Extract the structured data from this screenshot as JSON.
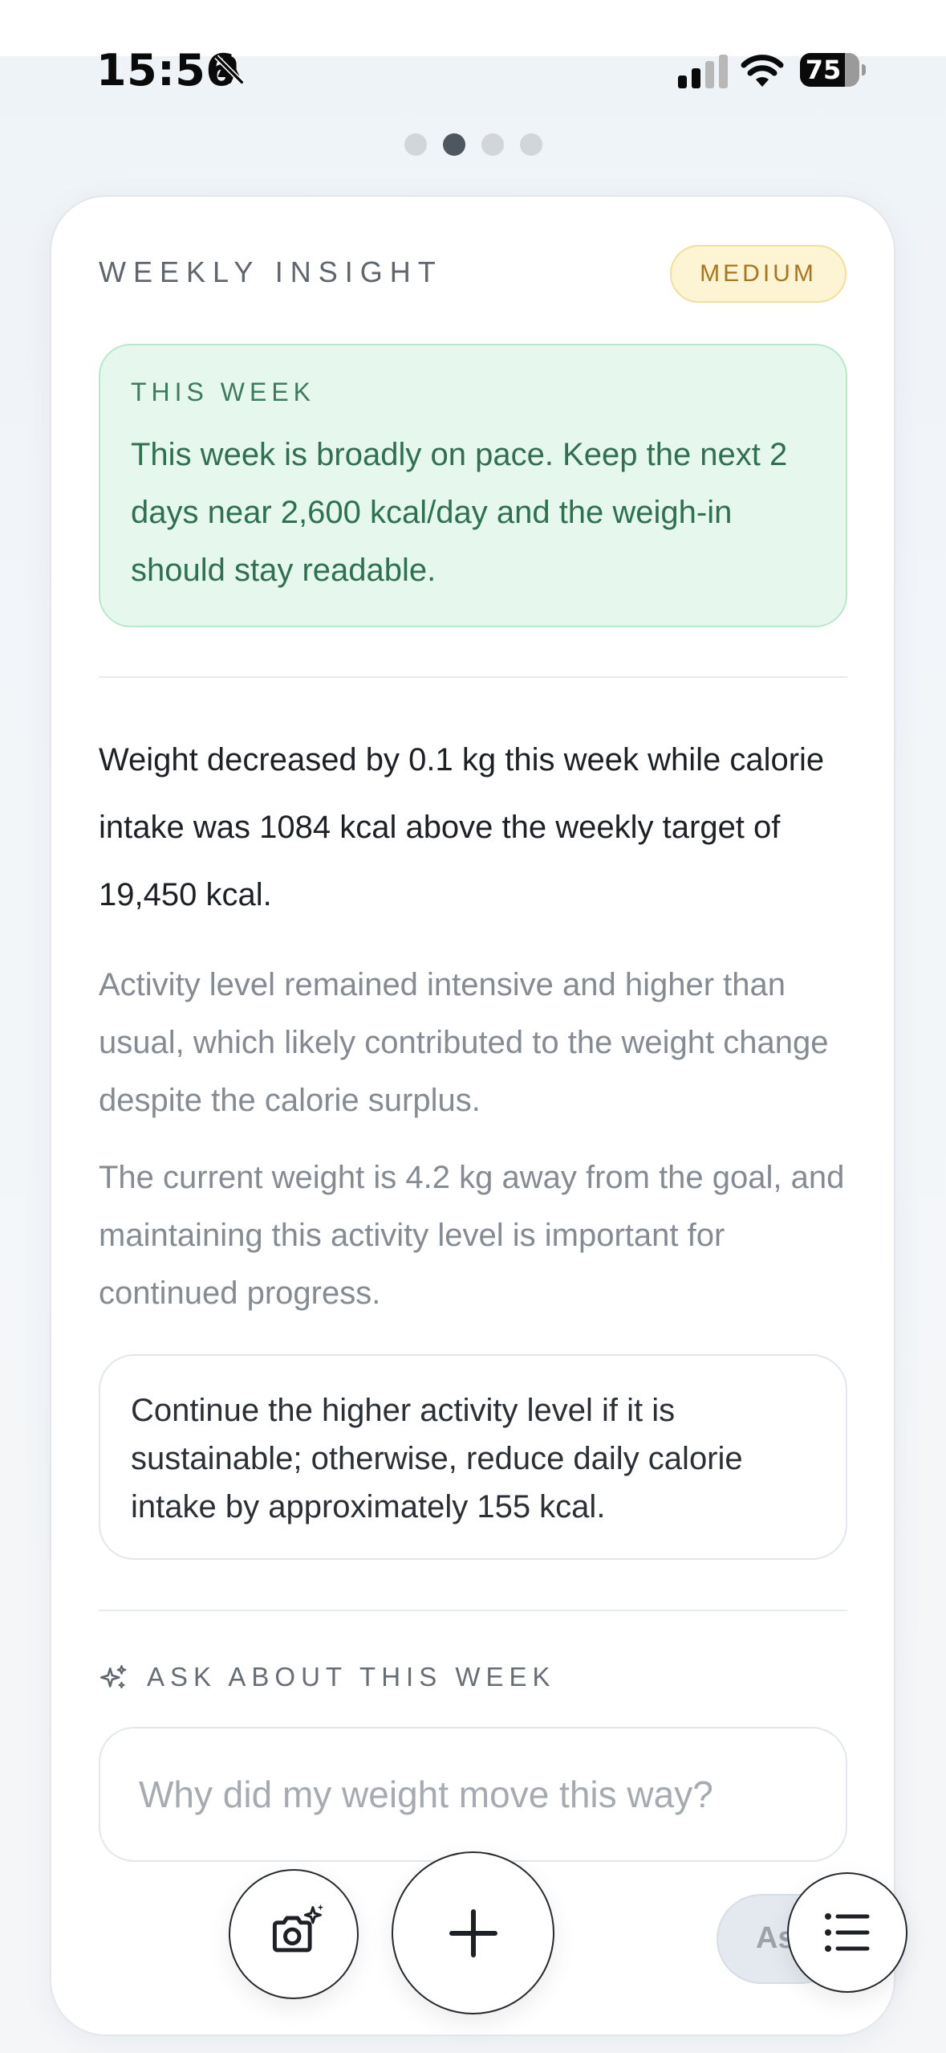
{
  "status_bar": {
    "time": "15:56",
    "battery_level": "75",
    "battery_fraction": 0.75,
    "icons": [
      "bell-slash-icon",
      "cellular-signal-icon",
      "wifi-icon",
      "battery-icon"
    ]
  },
  "pager": {
    "count": 4,
    "active_index": 1
  },
  "insight": {
    "title": "WEEKLY INSIGHT",
    "badge": "MEDIUM",
    "this_week": {
      "label": "THIS WEEK",
      "body": "This week is broadly on pace. Keep the next 2 days near 2,600 kcal/day and the weigh-in should stay readable."
    },
    "summary": "Weight decreased by 0.1 kg this week while calorie intake was 1084 kcal above the weekly target of 19,450 kcal.",
    "paragraph_1": "Activity level remained intensive and higher than usual, which likely contributed to the weight change despite the calorie surplus.",
    "paragraph_2": "The current weight is 4.2 kg away from the goal, and maintaining this activity level is important for continued progress.",
    "recommendation": "Continue the higher activity level if it is sustainable; otherwise, reduce daily calorie intake by approximately 155 kcal."
  },
  "ask": {
    "label": "ASK ABOUT THIS WEEK",
    "placeholder": "Why did my weight move this way?",
    "button_label": "As"
  },
  "colors": {
    "badge_bg": "#fdf4d3",
    "badge_text": "#a8761e",
    "this_week_bg": "#e6f8ee",
    "this_week_text": "#2f7050",
    "active_dot": "#4e5760"
  },
  "bottom_actions": [
    "camera-sparkle-icon",
    "plus-icon",
    "list-icon"
  ]
}
